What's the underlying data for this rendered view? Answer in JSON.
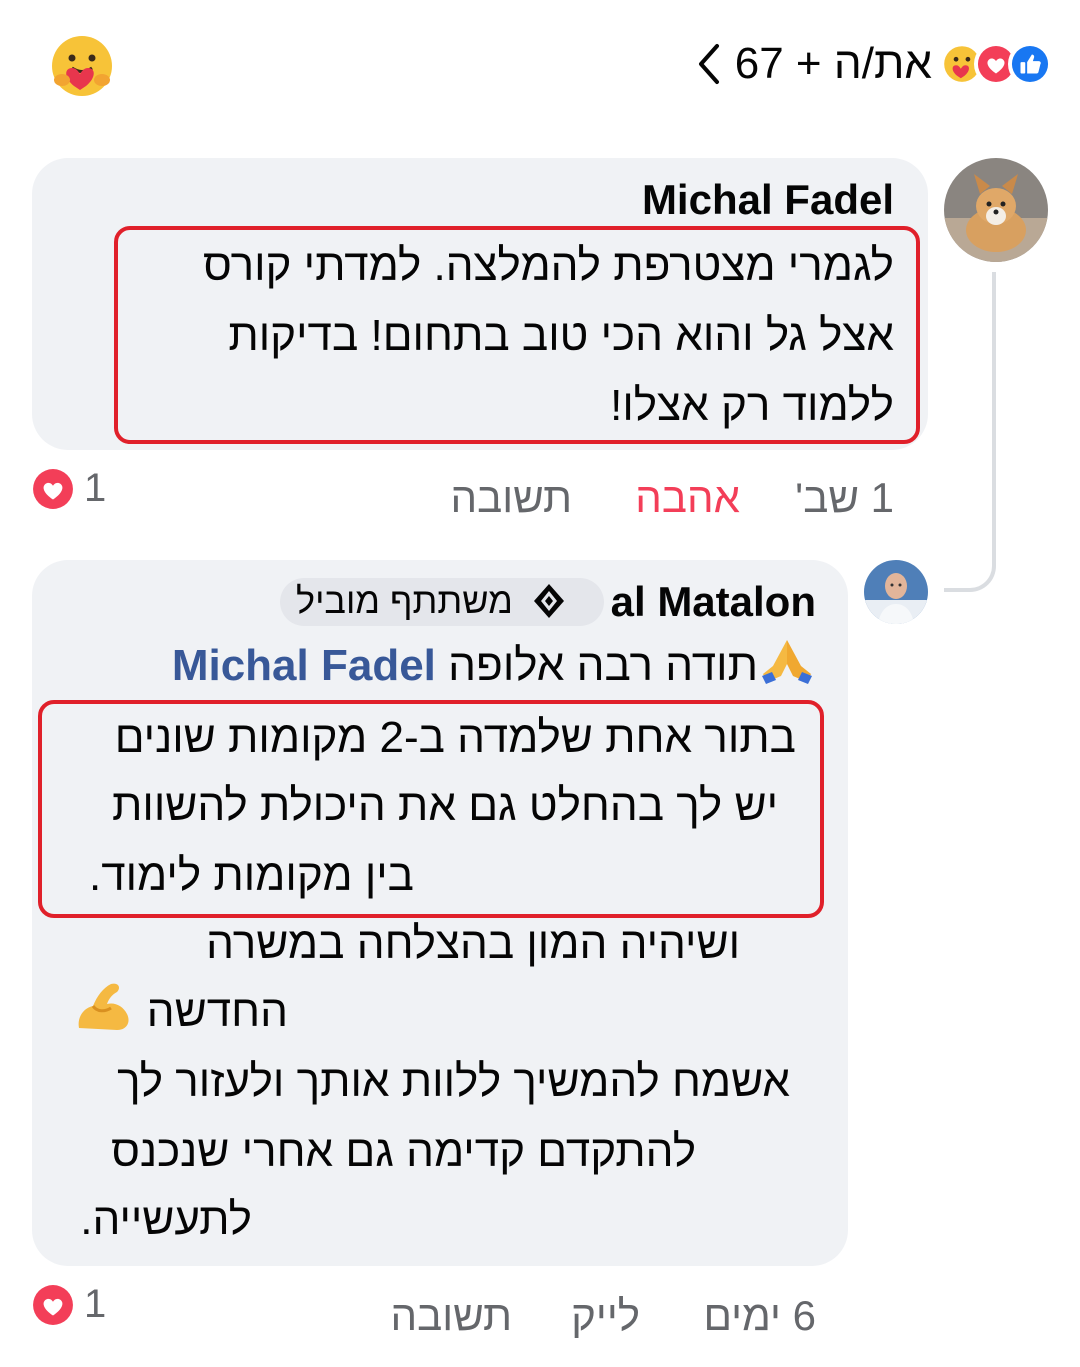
{
  "header": {
    "count_text": "את/ה + 67",
    "reaction_icons": [
      "care-icon",
      "love-icon",
      "like-icon"
    ],
    "back_icon": "chevron-left-icon",
    "care_icon": "care-icon"
  },
  "comment1": {
    "author": "Michal Fadel",
    "lines": [
      "לגמרי מצטרפת להמלצה. למדתי קורס",
      "אצל גל והוא הכי טוב בתחום! בדיקות",
      "ללמוד רק אצלו!"
    ],
    "time": "1 שב'",
    "love_action": "אהבה",
    "reply_action": "תשובה",
    "reaction_count": "1"
  },
  "comment2": {
    "author": "al Matalon",
    "badge": "משתתף מוביל",
    "greeting": "תודה רבה אלופה",
    "mention": "Michal Fadel",
    "lines": [
      "בתור אחת שלמדה ב-2 מקומות שונים",
      "יש לך בהחלט גם את היכולת להשוות",
      "בין מקומות לימוד.",
      "ושיהיה המון בהצלחה במשרה",
      "החדשה",
      "אשמח להמשיך ללוות אותך ולעזור לך",
      "להתקדם קדימה גם אחרי שנכנס",
      "לתעשייה."
    ],
    "time": "6 ימים",
    "like_action": "לייק",
    "reply_action": "תשובה",
    "reaction_count": "1"
  },
  "colors": {
    "highlight": "#e0202a",
    "love": "#f33e58",
    "bubble": "#f0f2f5",
    "link": "#385898",
    "like": "#1877f2"
  }
}
